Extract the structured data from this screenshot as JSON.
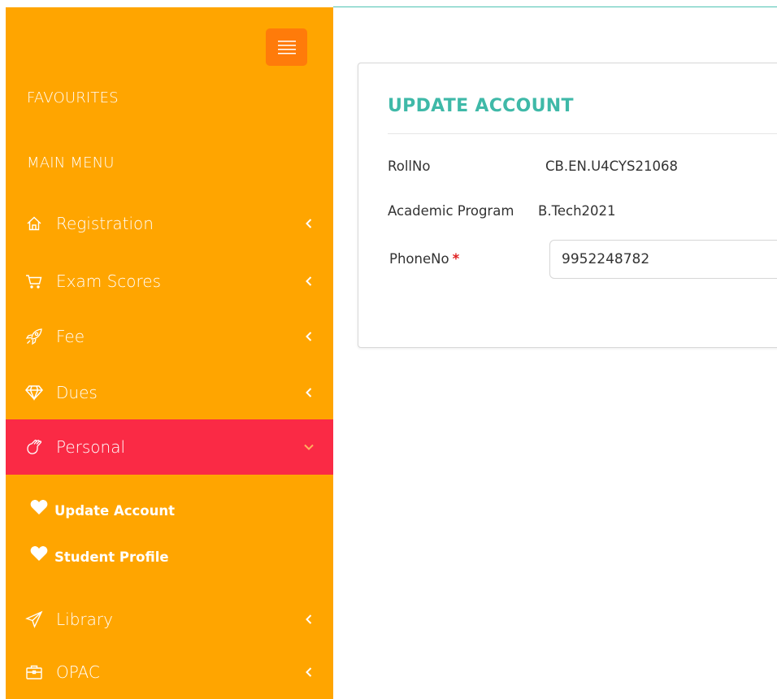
{
  "sidebar": {
    "favourites_heading": "FAVOURITES",
    "main_menu_heading": "MAIN MENU",
    "toggle_icon": "hamburger-menu-icon",
    "items": [
      {
        "label": "Registration",
        "icon": "home-icon",
        "expanded": false
      },
      {
        "label": "Exam Scores",
        "icon": "cart-icon",
        "expanded": false
      },
      {
        "label": "Fee",
        "icon": "rocket-icon",
        "expanded": false
      },
      {
        "label": "Dues",
        "icon": "diamond-icon",
        "expanded": false
      },
      {
        "label": "Personal",
        "icon": "hand-icon",
        "expanded": true,
        "children": [
          {
            "label": "Update Account",
            "icon": "heart-icon"
          },
          {
            "label": "Student Profile",
            "icon": "heart-icon"
          }
        ]
      },
      {
        "label": "Library",
        "icon": "paper-plane-icon",
        "expanded": false
      },
      {
        "label": "OPAC",
        "icon": "briefcase-icon",
        "expanded": false
      }
    ]
  },
  "form": {
    "title": "UPDATE ACCOUNT",
    "fields": [
      {
        "label": "RollNo",
        "value": "CB.EN.U4CYS21068"
      },
      {
        "label": "Academic Program",
        "value": "B.Tech2021"
      },
      {
        "label": "PhoneNo",
        "value": "9952248782",
        "required_mark": "*"
      }
    ]
  },
  "colors": {
    "sidebar_bg": "#ffa500",
    "active_item_bg": "#fa2a45",
    "toggle_bg": "#ff7b0a",
    "title_accent": "#3fb9a8"
  }
}
